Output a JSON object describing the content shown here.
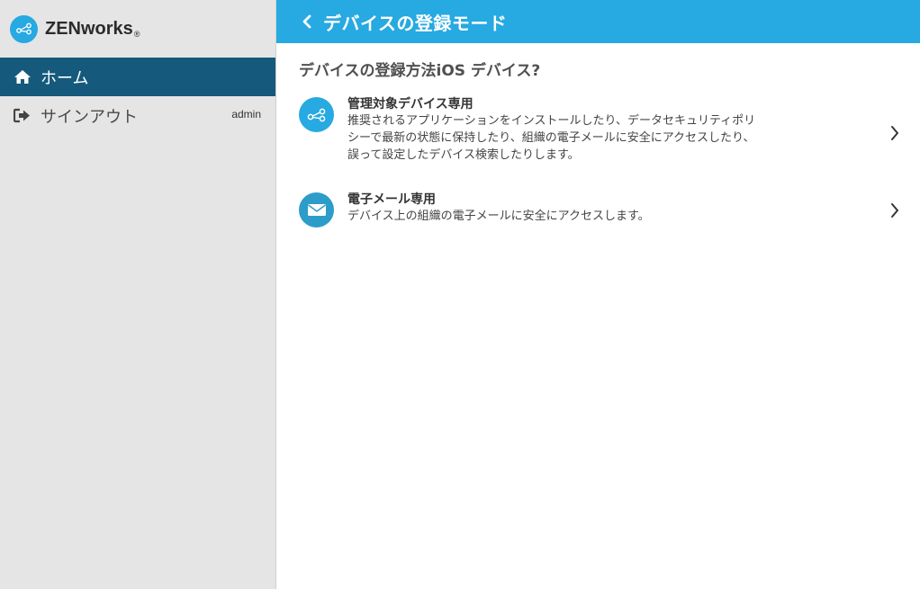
{
  "sidebar": {
    "brand": {
      "name": "ZENworks",
      "reg": "®"
    },
    "items": [
      {
        "label": "ホーム",
        "icon": "home-icon",
        "active": true
      },
      {
        "label": "サインアウト",
        "icon": "sign-out-icon",
        "user": "admin"
      }
    ]
  },
  "header": {
    "title": "デバイスの登録モード"
  },
  "main": {
    "question": "デバイスの登録方法iOS デバイス?",
    "options": [
      {
        "title": "管理対象デバイス専用",
        "desc_lines": [
          "推奨されるアプリケーションをインストールしたり、データセキュリティポリ",
          "シーで最新の状態に保持したり、組織の電子メールに安全にアクセスしたり、",
          "誤って設定したデバイス検索したりします。"
        ],
        "icon": "share-icon"
      },
      {
        "title": "電子メール専用",
        "desc_lines": [
          "デバイス上の組織の電子メールに安全にアクセスします。"
        ],
        "icon": "envelope-icon"
      }
    ]
  },
  "colors": {
    "accent": "#27a9e1",
    "active_nav": "#155a7c",
    "sidebar_bg": "#e5e5e5"
  }
}
